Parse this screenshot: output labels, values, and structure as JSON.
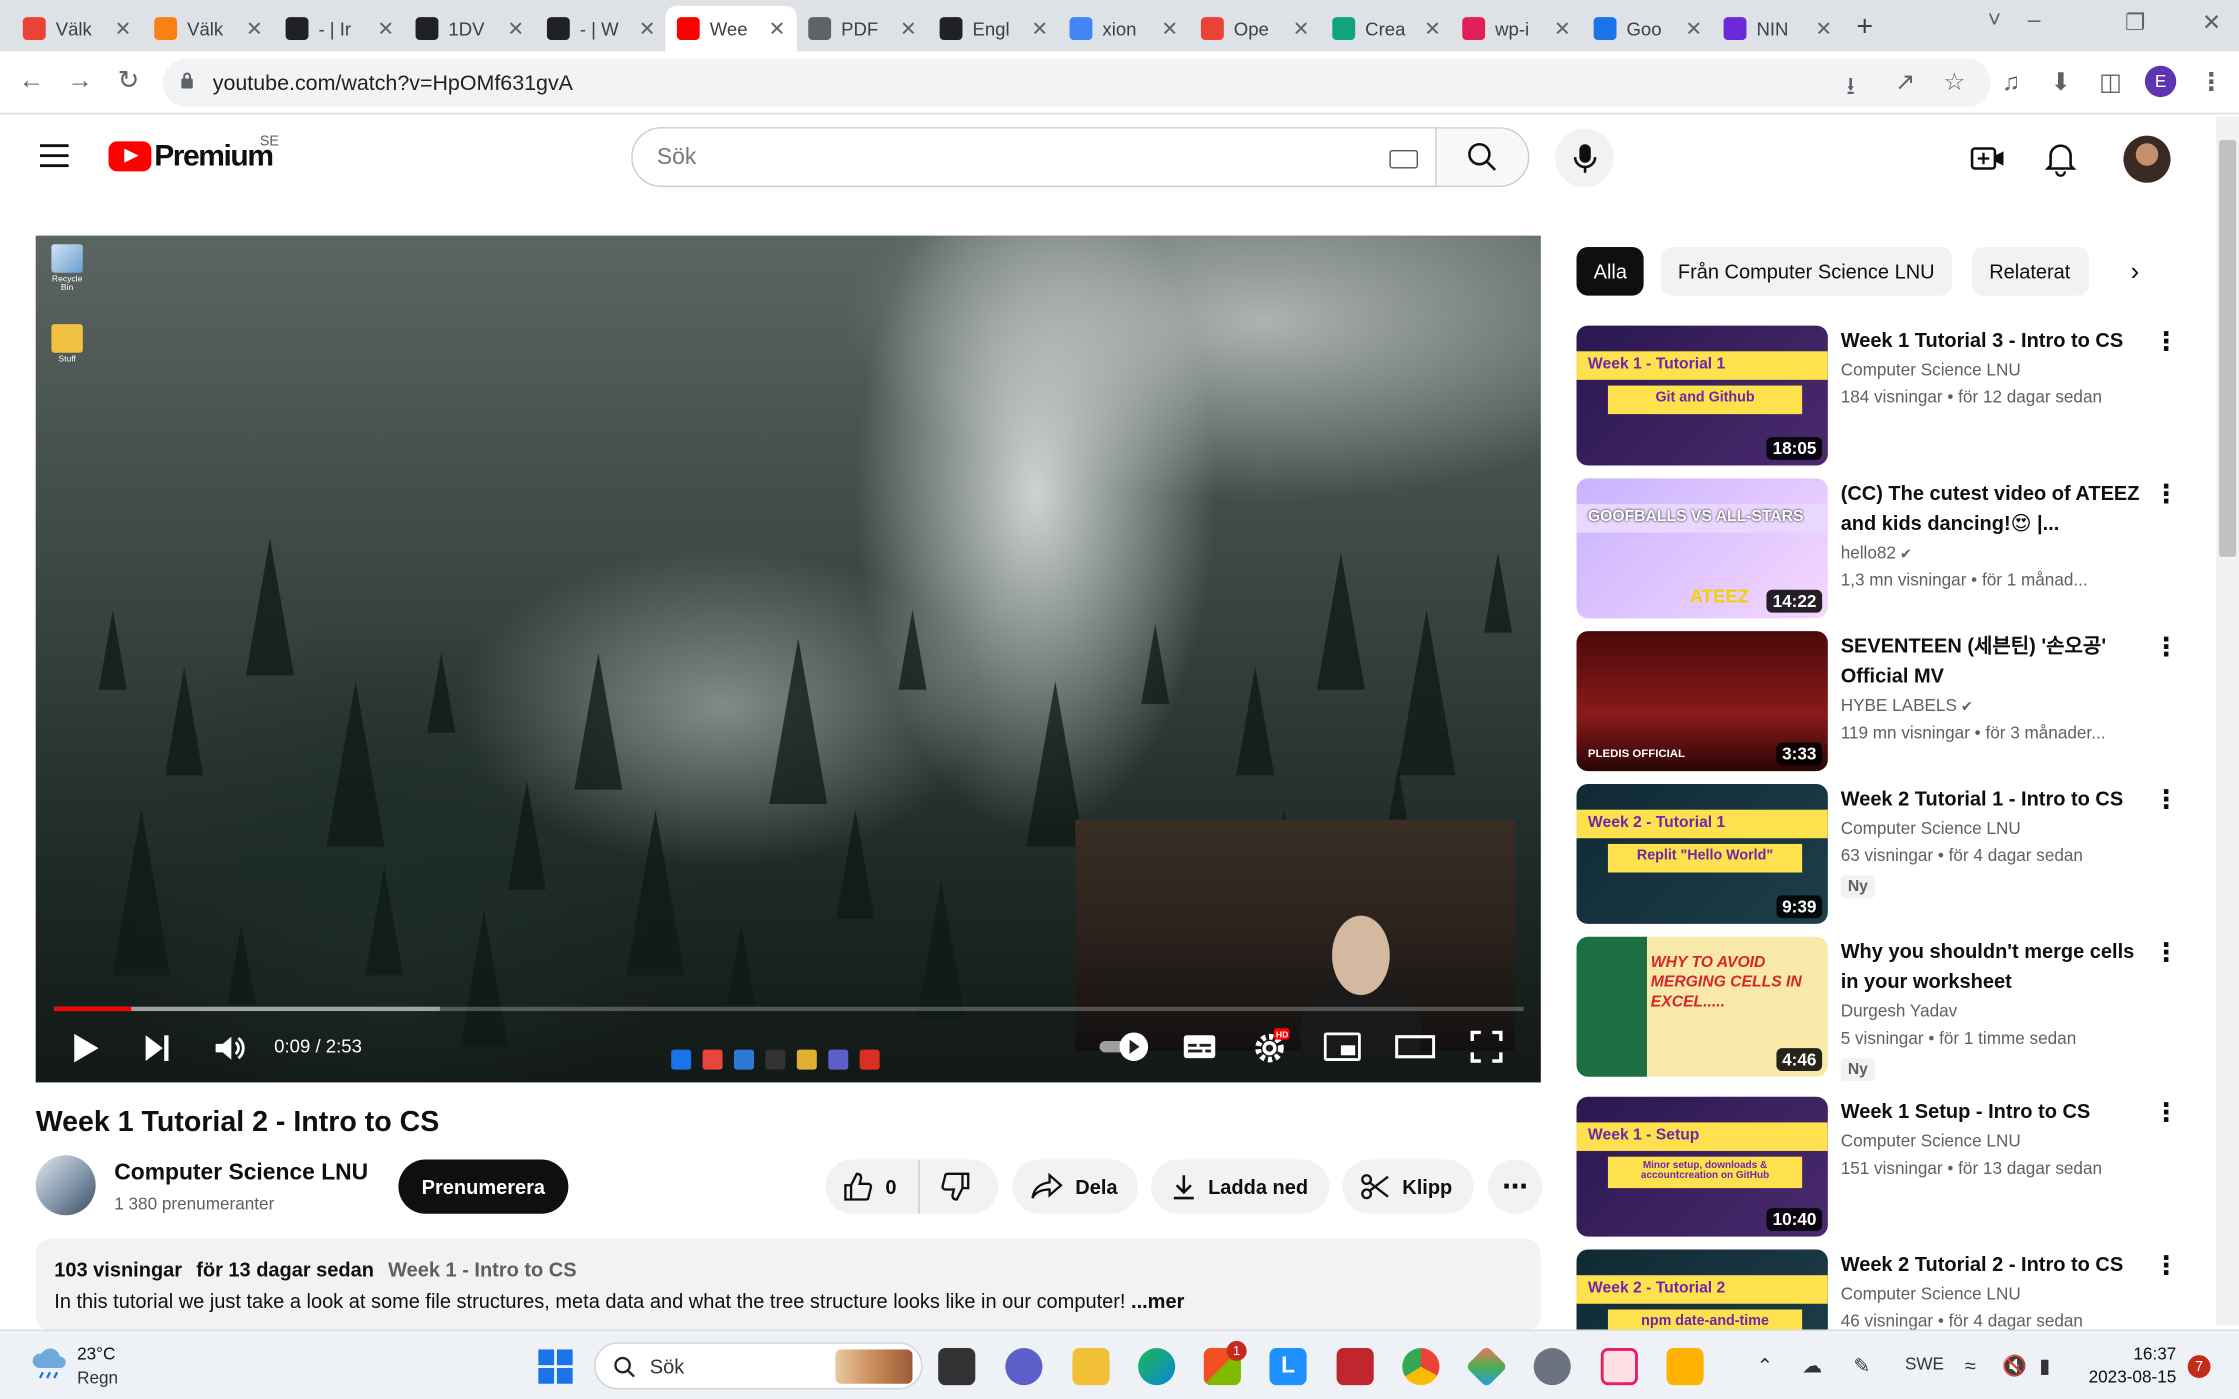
{
  "browser": {
    "tabs": [
      {
        "title": "Välk",
        "icon": "gmail-icon",
        "color": "#ea4335"
      },
      {
        "title": "Välk",
        "icon": "moodle-icon",
        "color": "#f98012"
      },
      {
        "title": "- | Ir",
        "icon": "tree-icon",
        "color": "#202124"
      },
      {
        "title": "1DV",
        "icon": "tree-icon",
        "color": "#202124"
      },
      {
        "title": "- | W",
        "icon": "tree-icon",
        "color": "#202124"
      },
      {
        "title": "Wee",
        "icon": "youtube-icon",
        "color": "#ff0000"
      },
      {
        "title": "PDF",
        "icon": "globe-icon",
        "color": "#5f6368"
      },
      {
        "title": "Engl",
        "icon": "github-icon",
        "color": "#202124"
      },
      {
        "title": "xion",
        "icon": "docs-icon",
        "color": "#4285f4"
      },
      {
        "title": "Ope",
        "icon": "gmail-icon",
        "color": "#ea4335"
      },
      {
        "title": "Crea",
        "icon": "chatgpt-icon",
        "color": "#10a37f"
      },
      {
        "title": "wp-i",
        "icon": "slack-icon",
        "color": "#e01e5a"
      },
      {
        "title": "Goo",
        "icon": "calendar-icon",
        "color": "#1a73e8"
      },
      {
        "title": "NIN",
        "icon": "k-icon",
        "color": "#6d28d9"
      }
    ],
    "url": "youtube.com/watch?v=HpOMf631gvA",
    "profile_initial": "E"
  },
  "header": {
    "logo_text": "Premium",
    "country": "SE",
    "search_placeholder": "Sök"
  },
  "player": {
    "time": "0:09 / 2:53",
    "progress": 0.052,
    "buffered": 0.262,
    "desktop_icons": [
      "Recycle Bin",
      "Stuff"
    ]
  },
  "video": {
    "title": "Week 1 Tutorial 2 - Intro to CS",
    "channel": "Computer Science LNU",
    "subscribers": "1 380 prenumeranter",
    "subscribe_label": "Prenumerera",
    "likes": "0",
    "share_label": "Dela",
    "download_label": "Ladda ned",
    "clip_label": "Klipp",
    "views": "103 visningar",
    "date": "för 13 dagar sedan",
    "playlist_tag": "Week 1 - Intro to CS",
    "description": "In this tutorial we just take a look at some file structures, meta data and what the tree structure looks like in our computer!",
    "more_label": "...mer"
  },
  "chips": [
    "Alla",
    "Från Computer Science LNU",
    "Relaterat"
  ],
  "recommendations": [
    {
      "title": "Week 1 Tutorial 3 - Intro to CS",
      "channel": "Computer Science LNU",
      "verified": false,
      "views": "184 visningar",
      "age": "för 12 dagar sedan",
      "duration": "18:05",
      "thumb_label": "Week 1 - Tutorial 1",
      "thumb_sub": "Git and Github",
      "badge": ""
    },
    {
      "title": "(CC) The cutest video of ATEEZ and kids dancing!😍 |...",
      "channel": "hello82",
      "verified": true,
      "views": "1,3 mn visningar",
      "age": "för 1 månad...",
      "duration": "14:22",
      "thumb_label": "GOOFBALLS VS ALL-STARS",
      "thumb_sub": "ATEEZ",
      "badge": ""
    },
    {
      "title": "SEVENTEEN (세븐틴) '손오공' Official MV",
      "channel": "HYBE LABELS",
      "verified": true,
      "views": "119 mn visningar",
      "age": "för 3 månader...",
      "duration": "3:33",
      "thumb_label": "PLEDIS OFFICIAL",
      "thumb_sub": "",
      "badge": ""
    },
    {
      "title": "Week 2 Tutorial 1 - Intro to CS",
      "channel": "Computer Science LNU",
      "verified": false,
      "views": "63 visningar",
      "age": "för 4 dagar sedan",
      "duration": "9:39",
      "thumb_label": "Week 2 - Tutorial 1",
      "thumb_sub": "Replit \"Hello World\"",
      "badge": "Ny"
    },
    {
      "title": "Why you shouldn't merge cells in your worksheet",
      "channel": "Durgesh Yadav",
      "verified": false,
      "views": "5 visningar",
      "age": "för 1 timme sedan",
      "duration": "4:46",
      "thumb_label": "WHY TO AVOID MERGING CELLS IN EXCEL.....",
      "thumb_sub": "",
      "badge": "Ny"
    },
    {
      "title": "Week 1 Setup - Intro to CS",
      "channel": "Computer Science LNU",
      "verified": false,
      "views": "151 visningar",
      "age": "för 13 dagar sedan",
      "duration": "10:40",
      "thumb_label": "Week 1 - Setup",
      "thumb_sub": "Minor setup, downloads & accountcreation on GitHub",
      "badge": ""
    },
    {
      "title": "Week 2 Tutorial 2 - Intro to CS",
      "channel": "Computer Science LNU",
      "verified": false,
      "views": "46 visningar",
      "age": "för 4 dagar sedan",
      "duration": "",
      "thumb_label": "Week 2 - Tutorial 2",
      "thumb_sub": "npm date-and-time",
      "badge": ""
    }
  ],
  "taskbar": {
    "temperature": "23°C",
    "condition": "Regn",
    "search_placeholder": "Sök",
    "language": "SWE",
    "time": "16:37",
    "date": "2023-08-15",
    "notifications": "7",
    "teams_badge": "1"
  }
}
